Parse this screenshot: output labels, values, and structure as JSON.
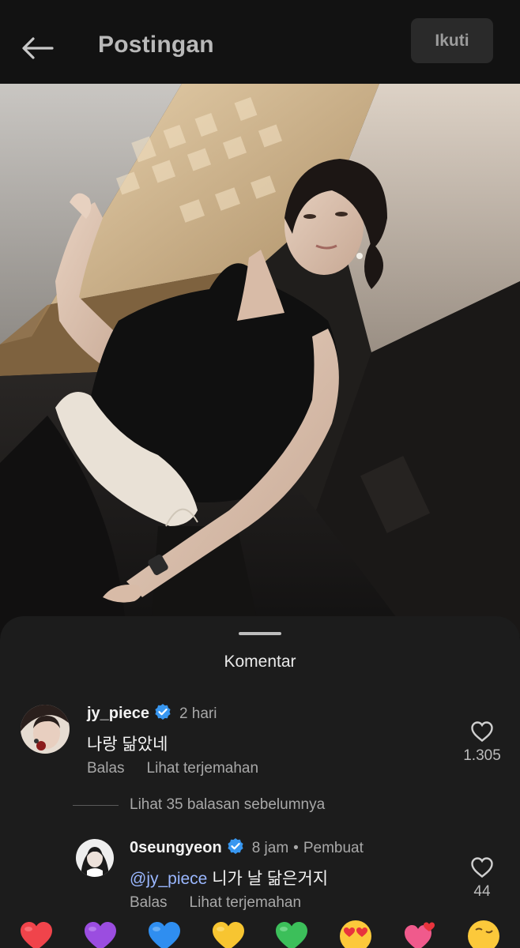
{
  "header": {
    "title": "Postingan",
    "follow_label": "Ikuti"
  },
  "comments_sheet": {
    "title": "Komentar",
    "comments": [
      {
        "username": "jy_piece",
        "verified": true,
        "time": "2 hari",
        "text": "나랑 닮았네",
        "reply_label": "Balas",
        "translate_label": "Lihat terjemahan",
        "like_count": "1.305"
      },
      {
        "username": "0seungyeon",
        "verified": true,
        "time": "8 jam",
        "separator": "•",
        "author_tag": "Pembuat",
        "mention": "@jy_piece",
        "text": "니가 날 닮은거지",
        "reply_label": "Balas",
        "translate_label": "Lihat terjemahan",
        "like_count": "44"
      }
    ],
    "view_more_replies": "Lihat 35 balasan sebelumnya"
  },
  "reactions": [
    "red-heart-emoji",
    "purple-heart-emoji",
    "blue-heart-emoji",
    "yellow-heart-emoji",
    "green-heart-emoji",
    "heart-eyes-emoji",
    "hearts-emoji",
    "kissing-emoji"
  ],
  "colors": {
    "background": "#121212",
    "sheet": "#1c1c1c",
    "verified_badge": "#3897f0",
    "mention": "#9ab7ff",
    "muted_text": "#a8a8a8"
  }
}
